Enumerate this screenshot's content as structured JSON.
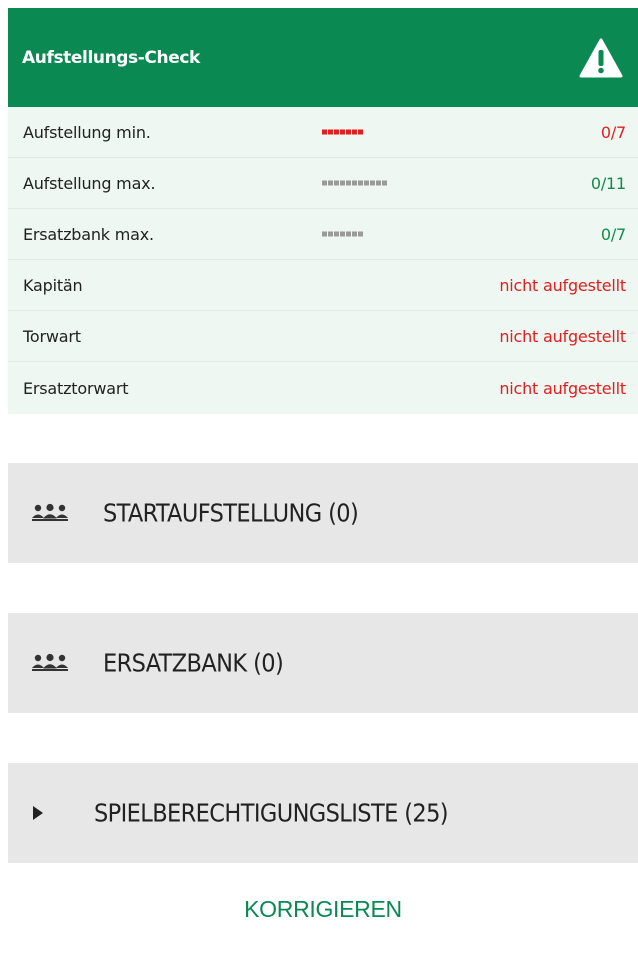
{
  "check": {
    "title": "Aufstellungs-Check",
    "rows": [
      {
        "label": "Aufstellung min.",
        "value": "0/7",
        "dots": 7,
        "dot_color": "#e01f1f",
        "status": "error"
      },
      {
        "label": "Aufstellung max.",
        "value": "0/11",
        "dots": 11,
        "dot_color": "#9a9a9a",
        "status": "ok"
      },
      {
        "label": "Ersatzbank max.",
        "value": "0/7",
        "dots": 7,
        "dot_color": "#9a9a9a",
        "status": "ok"
      },
      {
        "label": "Kapitän",
        "value": "nicht aufgestellt",
        "status": "error"
      },
      {
        "label": "Torwart",
        "value": "nicht aufgestellt",
        "status": "error"
      },
      {
        "label": "Ersatztorwart",
        "value": "nicht aufgestellt",
        "status": "error"
      }
    ]
  },
  "sections": {
    "start": {
      "label": "STARTAUFSTELLUNG (0)",
      "icon": "group-icon"
    },
    "bench": {
      "label": "ERSATZBANK (0)",
      "icon": "group-icon"
    },
    "eligible": {
      "label": "SPIELBERECHTIGUNGSLISTE (25)",
      "icon": "caret-right-icon"
    }
  },
  "actions": {
    "correct_label": "KORRIGIEREN"
  },
  "colors": {
    "header_bg": "#0a8a52",
    "error": "#e01f1f",
    "ok": "#128c4a",
    "panel_bg": "#eef7f2",
    "accordion_bg": "#e7e7e7"
  }
}
